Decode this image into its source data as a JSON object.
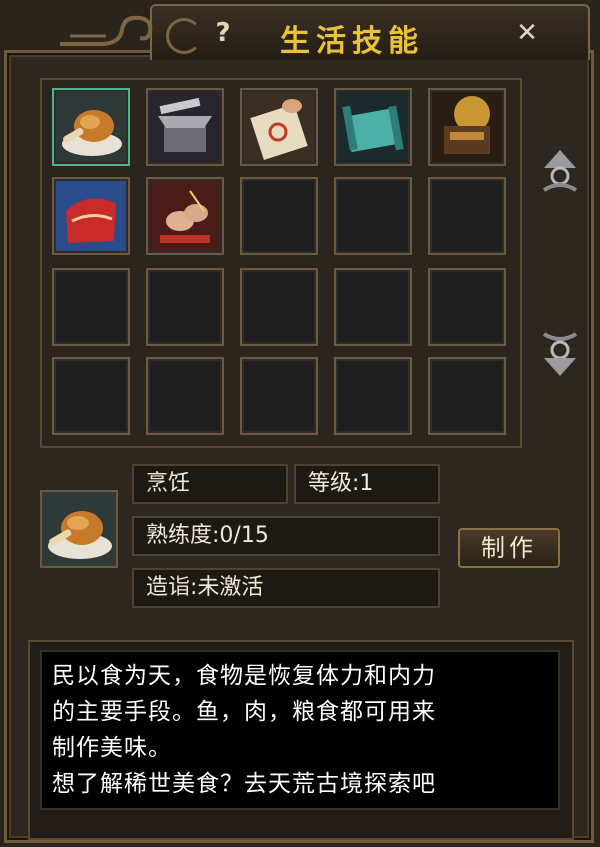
{
  "window": {
    "title": "生活技能",
    "help_label": "?",
    "close_label": "✕"
  },
  "skills": [
    {
      "name": "cooking",
      "icon": "roast-chicken-icon"
    },
    {
      "name": "forging",
      "icon": "anvil-icon"
    },
    {
      "name": "talisman",
      "icon": "talisman-scroll-icon"
    },
    {
      "name": "scroll",
      "icon": "jade-scroll-icon"
    },
    {
      "name": "crafting",
      "icon": "glowing-chest-icon"
    },
    {
      "name": "tailoring",
      "icon": "red-fabric-icon"
    },
    {
      "name": "embroidery",
      "icon": "needle-hands-icon"
    }
  ],
  "selected_skill": {
    "name_label": "烹饪",
    "level_label": "等级:1",
    "proficiency_label": "熟练度:0/15",
    "mastery_label": "造诣:未激活",
    "make_label": "制作"
  },
  "description": {
    "line1": "民以食为天，食物是恢复体力和内力",
    "line2": "的主要手段。鱼，肉，粮食都可用来",
    "line3": "制作美味。",
    "line4": "想了解稀世美食？去天荒古境探索吧"
  },
  "colors": {
    "title": "#e8c23a",
    "frame": "#6e5a3c",
    "selected_slot": "#4fb38f",
    "text": "#f2ead8"
  }
}
